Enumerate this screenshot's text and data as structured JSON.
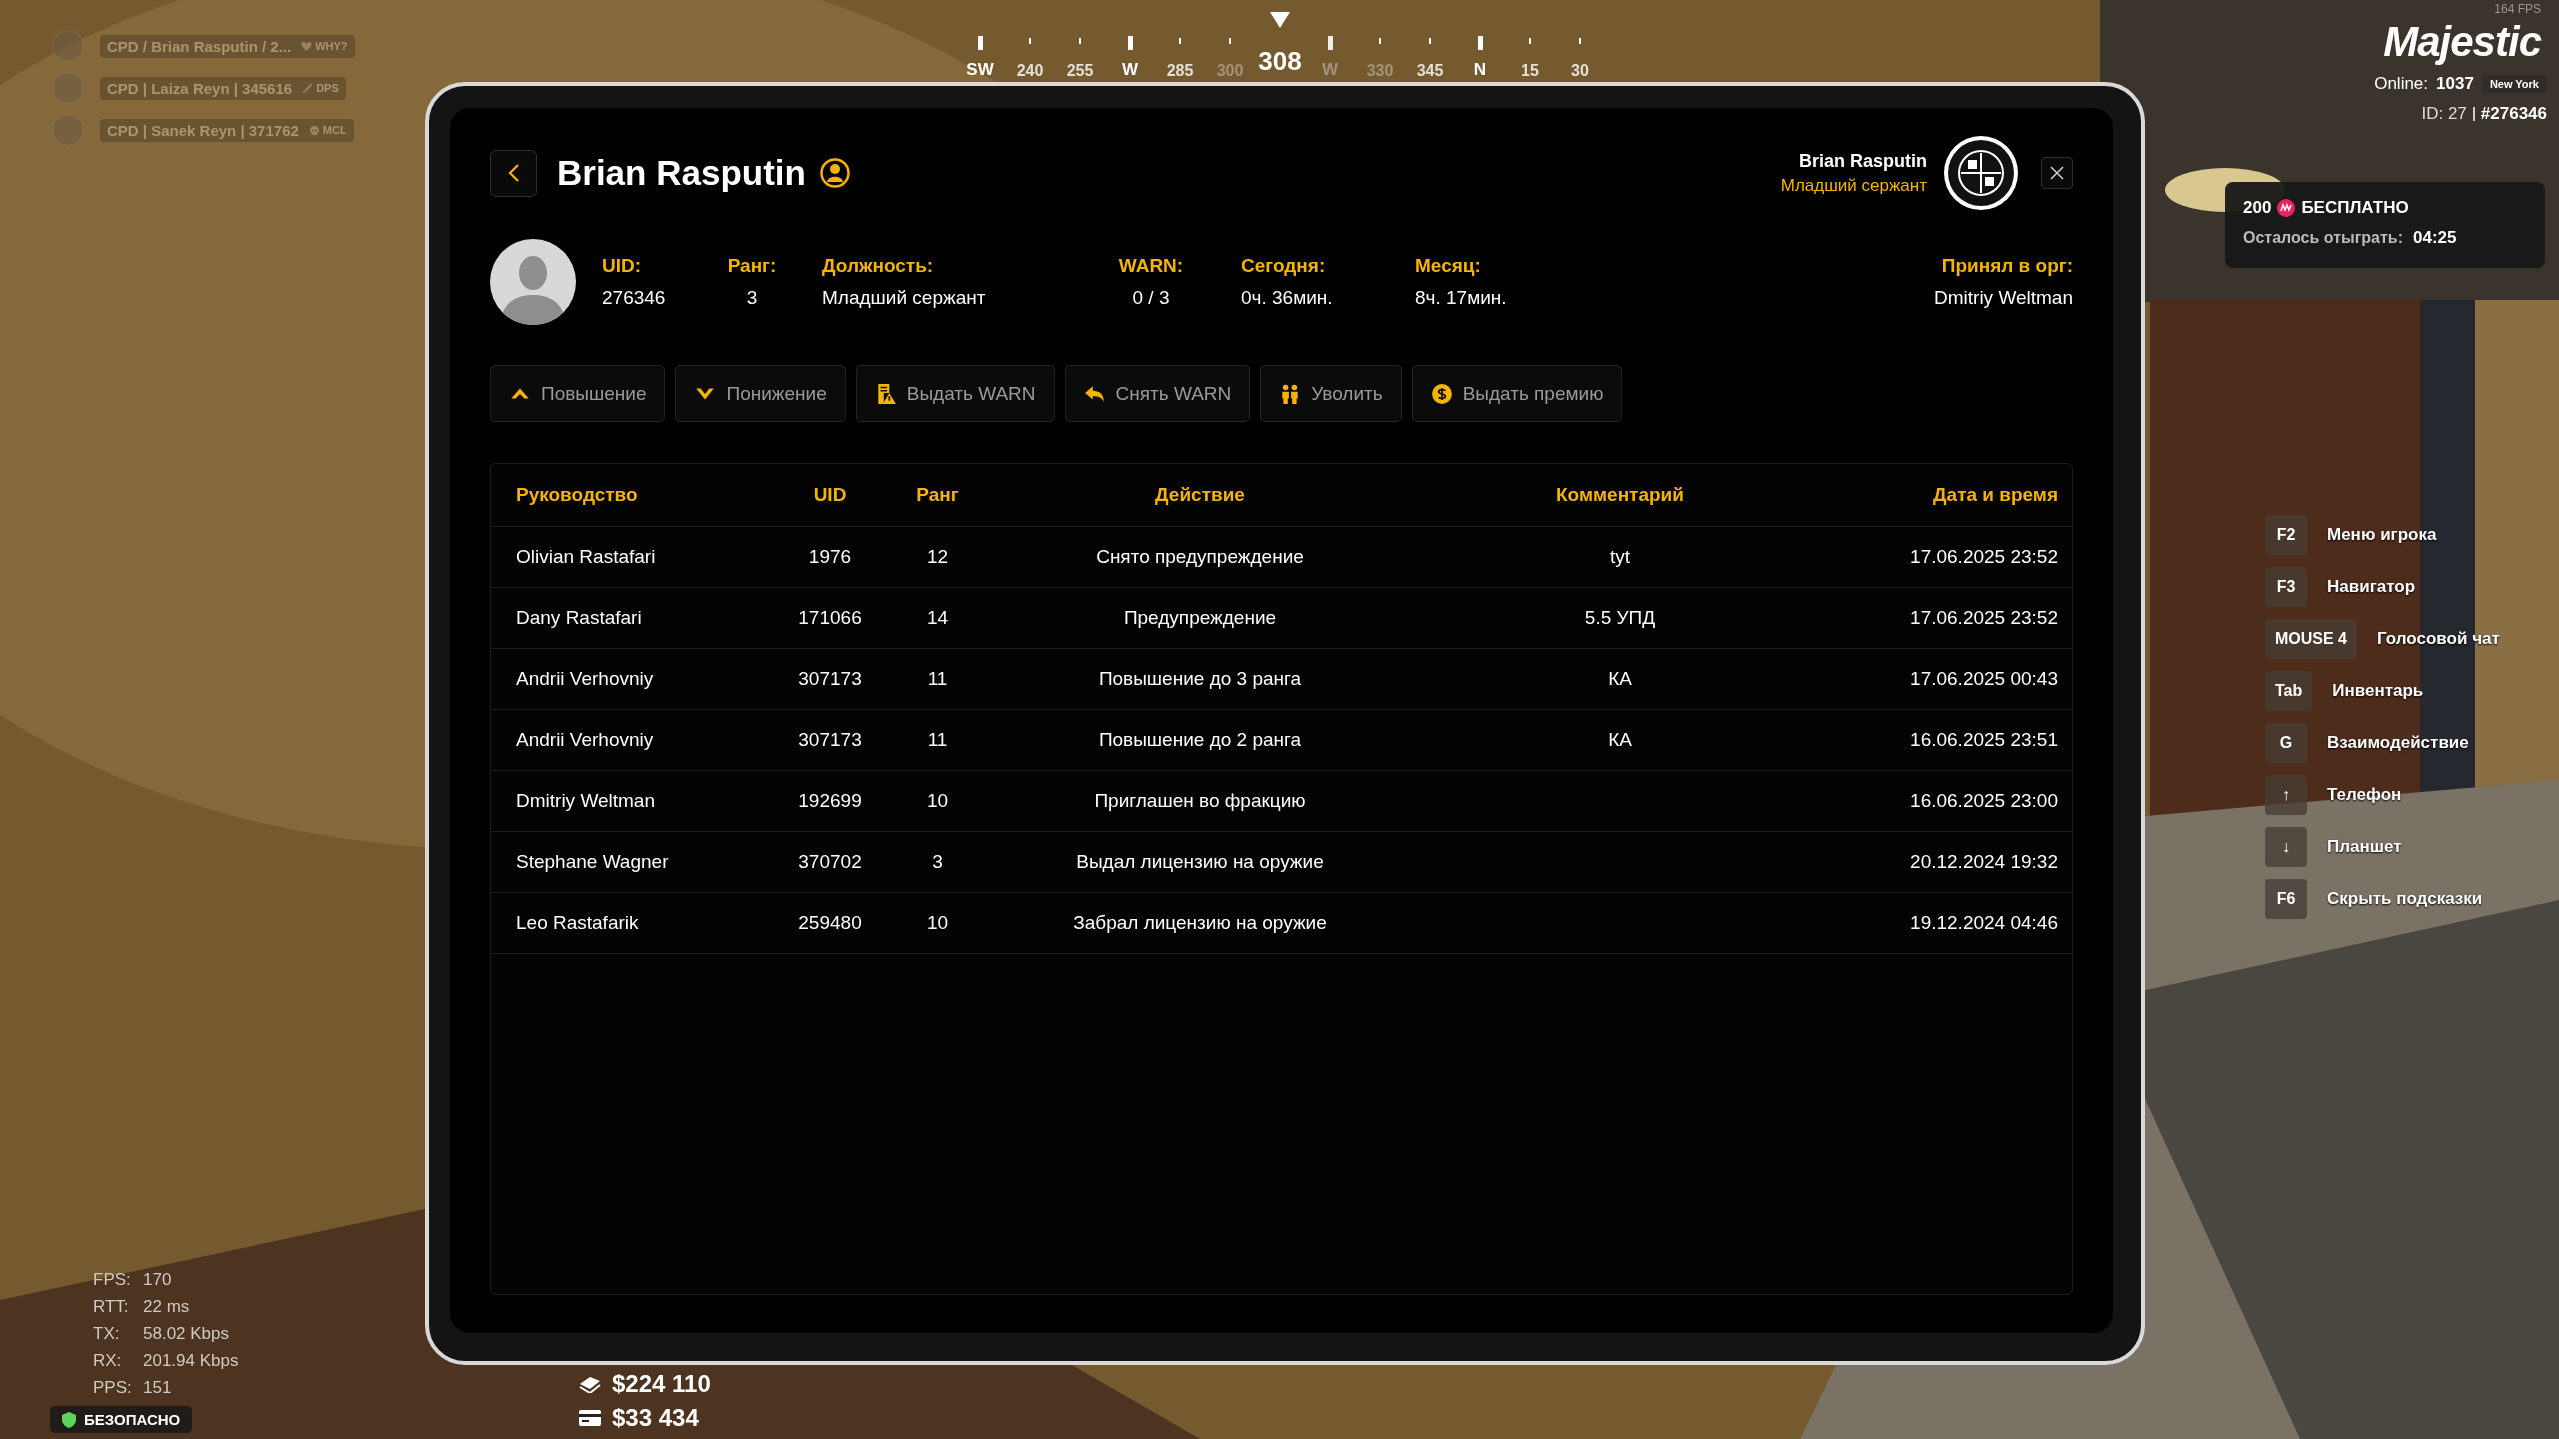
{
  "player_tags": [
    {
      "name": "CPD / Brian Rasputin / 2...",
      "badge": "WHY?",
      "kind": "heart"
    },
    {
      "name": "CPD | Laiza Reyn | 345616",
      "badge": "DPS",
      "kind": "sword"
    },
    {
      "name": "CPD | Sanek Reyn | 371762",
      "badge": "MCL",
      "kind": "skull"
    }
  ],
  "compass": {
    "marks": [
      {
        "label": "SW",
        "kind": "cardinal",
        "dimmed": false
      },
      {
        "label": "240",
        "kind": "degree",
        "dimmed": false
      },
      {
        "label": "255",
        "kind": "degree",
        "dimmed": false
      },
      {
        "label": "W",
        "kind": "cardinal",
        "dimmed": false
      },
      {
        "label": "285",
        "kind": "degree",
        "dimmed": false
      },
      {
        "label": "300",
        "kind": "degree",
        "dimmed": true
      },
      {
        "label": "308",
        "kind": "current",
        "dimmed": false
      },
      {
        "label": "W",
        "kind": "cardinal",
        "dimmed": true
      },
      {
        "label": "330",
        "kind": "degree",
        "dimmed": true
      },
      {
        "label": "345",
        "kind": "degree",
        "dimmed": false
      },
      {
        "label": "N",
        "kind": "cardinal",
        "dimmed": false
      },
      {
        "label": "15",
        "kind": "degree",
        "dimmed": false
      },
      {
        "label": "30",
        "kind": "degree",
        "dimmed": false
      }
    ]
  },
  "server": {
    "fps": "164 FPS",
    "logo": "Majestic",
    "online_label": "Online:",
    "online": "1037",
    "region": "New York",
    "id_label": "ID: 27",
    "account": "#276346"
  },
  "promo": {
    "amount": "200",
    "title": "БЕСПЛАТНО",
    "remaining_label": "Осталось отыграть:",
    "remaining": "04:25"
  },
  "hints": [
    {
      "key": "F2",
      "label": "Меню игрока"
    },
    {
      "key": "F3",
      "label": "Навигатор"
    },
    {
      "key": "MOUSE 4",
      "label": "Голосовой чат"
    },
    {
      "key": "Tab",
      "label": "Инвентарь"
    },
    {
      "key": "G",
      "label": "Взаимодействие"
    },
    {
      "key": "↑",
      "label": "Телефон"
    },
    {
      "key": "↓",
      "label": "Планшет"
    },
    {
      "key": "F6",
      "label": "Скрыть подсказки"
    }
  ],
  "net_stats": [
    {
      "label": "FPS:",
      "value": "170"
    },
    {
      "label": "RTT:",
      "value": "22 ms"
    },
    {
      "label": "TX:",
      "value": "58.02 Kbps"
    },
    {
      "label": "RX:",
      "value": "201.94 Kbps"
    },
    {
      "label": "PPS:",
      "value": "151"
    }
  ],
  "safe_zone": "БЕЗОПАСНО",
  "money": [
    {
      "kind": "cash",
      "amount": "$224 110"
    },
    {
      "kind": "card",
      "amount": "$33 434"
    }
  ],
  "profile": {
    "title": "Brian Rasputin",
    "header_name": "Brian Rasputin",
    "header_rank": "Младший сержант",
    "fields": [
      {
        "label": "UID:",
        "value": "276346"
      },
      {
        "label": "Ранг:",
        "value": "3"
      },
      {
        "label": "Должность:",
        "value": "Младший сержант"
      },
      {
        "label": "WARN:",
        "value": "0 / 3"
      },
      {
        "label": "Сегодня:",
        "value": "0ч. 36мин."
      },
      {
        "label": "Месяц:",
        "value": "8ч. 17мин."
      }
    ],
    "hired_by": {
      "label": "Принял в орг:",
      "value": "Dmitriy Weltman"
    },
    "actions": [
      {
        "label": "Повышение",
        "kind": "promote"
      },
      {
        "label": "Понижение",
        "kind": "demote"
      },
      {
        "label": "Выдать WARN",
        "kind": "warn"
      },
      {
        "label": "Снять WARN",
        "kind": "unwarn"
      },
      {
        "label": "Уволить",
        "kind": "fire"
      },
      {
        "label": "Выдать премию",
        "kind": "bonus"
      }
    ]
  },
  "table": {
    "columns": [
      "Руководство",
      "UID",
      "Ранг",
      "Действие",
      "Комментарий",
      "Дата и время"
    ],
    "rows": [
      [
        "Olivian Rastafari",
        "1976",
        "12",
        "Снято предупреждение",
        "tyt",
        "17.06.2025 23:52"
      ],
      [
        "Dany Rastafari",
        "171066",
        "14",
        "Предупреждение",
        "5.5 УПД",
        "17.06.2025 23:52"
      ],
      [
        "Andrii Verhovniy",
        "307173",
        "11",
        "Повышение до 3 ранга",
        "КА",
        "17.06.2025 00:43"
      ],
      [
        "Andrii Verhovniy",
        "307173",
        "11",
        "Повышение до 2 ранга",
        "КА",
        "16.06.2025 23:51"
      ],
      [
        "Dmitriy Weltman",
        "192699",
        "10",
        "Приглашен во фракцию",
        "",
        "16.06.2025 23:00"
      ],
      [
        "Stephane Wagner",
        "370702",
        "3",
        "Выдал лицензию на оружие",
        "",
        "20.12.2024 19:32"
      ],
      [
        "Leo Rastafarik",
        "259480",
        "10",
        "Забрал лицензию на оружие",
        "",
        "19.12.2024 04:46"
      ]
    ]
  }
}
